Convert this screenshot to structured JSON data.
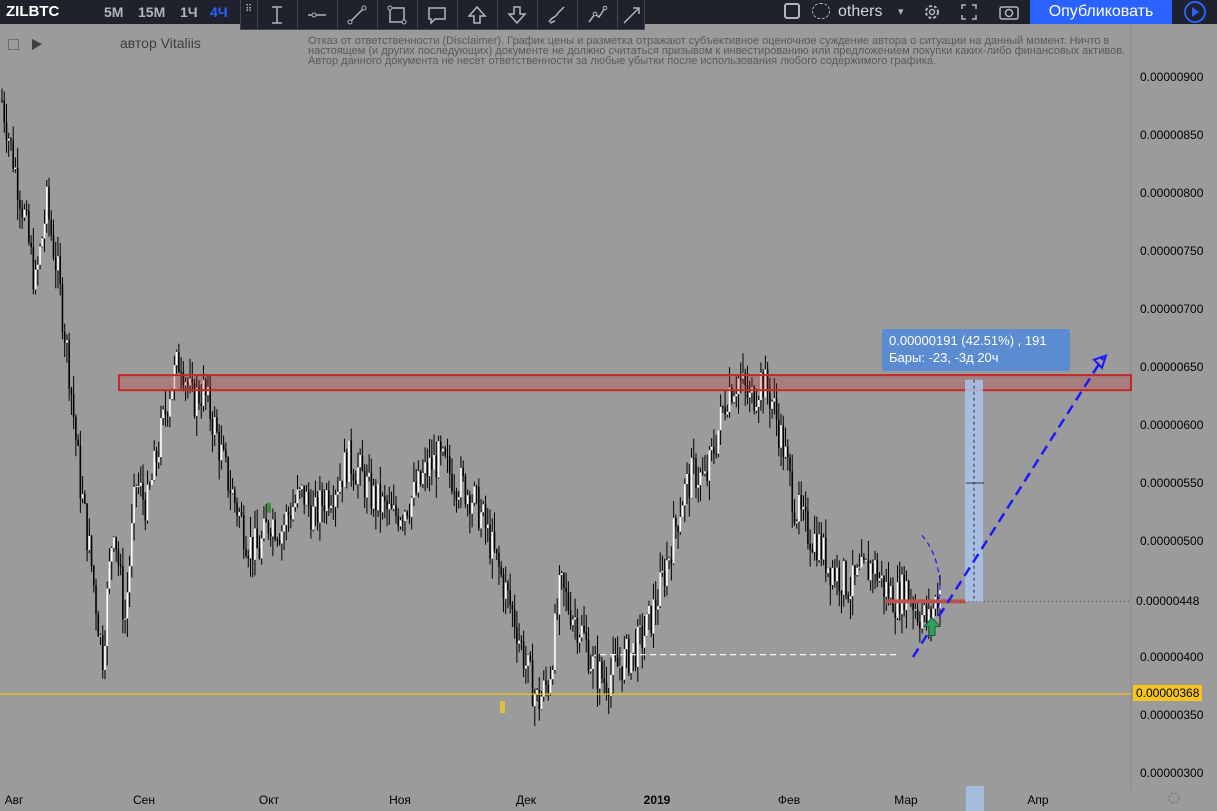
{
  "symbol": "ZILBTC",
  "toolbar": {
    "timeframes": [
      "5M",
      "15M",
      "1Ч",
      "4Ч"
    ],
    "active_timeframe": "4Ч",
    "drawing_tools": [
      "text-cursor-icon",
      "horizontal-line-icon",
      "trend-line-icon",
      "rectangle-icon",
      "comment-icon",
      "arrow-up-icon",
      "arrow-down-icon",
      "brush-icon",
      "path-icon",
      "trend-arrow-icon"
    ],
    "compare_label": "others",
    "publish_label": "Опубликовать"
  },
  "author": "автор Vitaliis",
  "disclaimer": "Отказ от ответственности (Disclaimer). График цены и разметка отражают субъективное оценочное суждение автора о ситуации на данный момент. Ничто в настоящем (и других последующих) документе не должно считаться призывом к инвестированию или предложением покупки каких-либо финансовых активов.\nАвтор данного документа не несет ответственности за любые убытки после использования любого содержимого графика.",
  "measure": {
    "line1": "0.00000191 (42.51%) , 191",
    "line2": "Бары: -23, -3д 20ч"
  },
  "colors": {
    "background": "#9b9b9b",
    "candles": "#000000",
    "resistance_zone": "#c62828",
    "support_line": "#f5c518",
    "projection": "#1a1aff",
    "measure": "#a9c4ec",
    "accent": "#2962ff"
  },
  "chart_data": {
    "type": "candlestick",
    "title": "ZILBTC",
    "xlabel": "",
    "ylabel": "",
    "grid": false,
    "ylim": [
      2.9e-06,
      9.2e-06
    ],
    "x_ticks": [
      "Авг",
      "Сен",
      "Окт",
      "Ноя",
      "Дек",
      "2019",
      "Фев",
      "Мар",
      "Апр"
    ],
    "y_ticks": [
      "0.00000900",
      "0.00000850",
      "0.00000800",
      "0.00000750",
      "0.00000700",
      "0.00000650",
      "0.00000600",
      "0.00000550",
      "0.00000500",
      "0.00000400",
      "0.00000350",
      "0.00000300"
    ],
    "current_price": "0.00000448",
    "support_price": "0.00000368",
    "series": [
      {
        "values": [
          8.8,
          8.3,
          7.8,
          7.2,
          7.9,
          7.3,
          6.5,
          5.5,
          4.8,
          4.0,
          5.2,
          4.3,
          5.5,
          5.3,
          5.8,
          6.3,
          6.6,
          6.2,
          6.3,
          6.0,
          5.6,
          5.3,
          5.0,
          4.9,
          5.2,
          5.1,
          5.3,
          5.4,
          5.2,
          5.4,
          5.5,
          5.7,
          5.6,
          5.4,
          5.3,
          5.2,
          5.3,
          5.4,
          5.6,
          5.7,
          5.6,
          5.5,
          5.4,
          5.2,
          4.9,
          4.6,
          4.3,
          3.9,
          3.6,
          3.8,
          4.6,
          4.4,
          4.2,
          3.9,
          3.8,
          3.9,
          4.0,
          4.1,
          4.3,
          4.6,
          5.0,
          5.4,
          5.6,
          5.5,
          5.9,
          6.3,
          6.4,
          6.2,
          6.4,
          6.2,
          5.8,
          5.3,
          5.1,
          5.0,
          4.8,
          4.7,
          4.6,
          4.7,
          4.8,
          4.6,
          4.5,
          4.6,
          4.4,
          4.3,
          4.6
        ]
      }
    ],
    "annotations": [
      {
        "type": "zone",
        "label": "resistance",
        "low": 6.3e-06,
        "high": 6.43e-06
      },
      {
        "type": "horizontal",
        "label": "support",
        "value": 3.68e-06
      },
      {
        "type": "measure",
        "from": 4.48e-06,
        "to": 6.39e-06
      },
      {
        "type": "projection",
        "from": 4e-06,
        "to": 6.58e-06
      }
    ]
  }
}
